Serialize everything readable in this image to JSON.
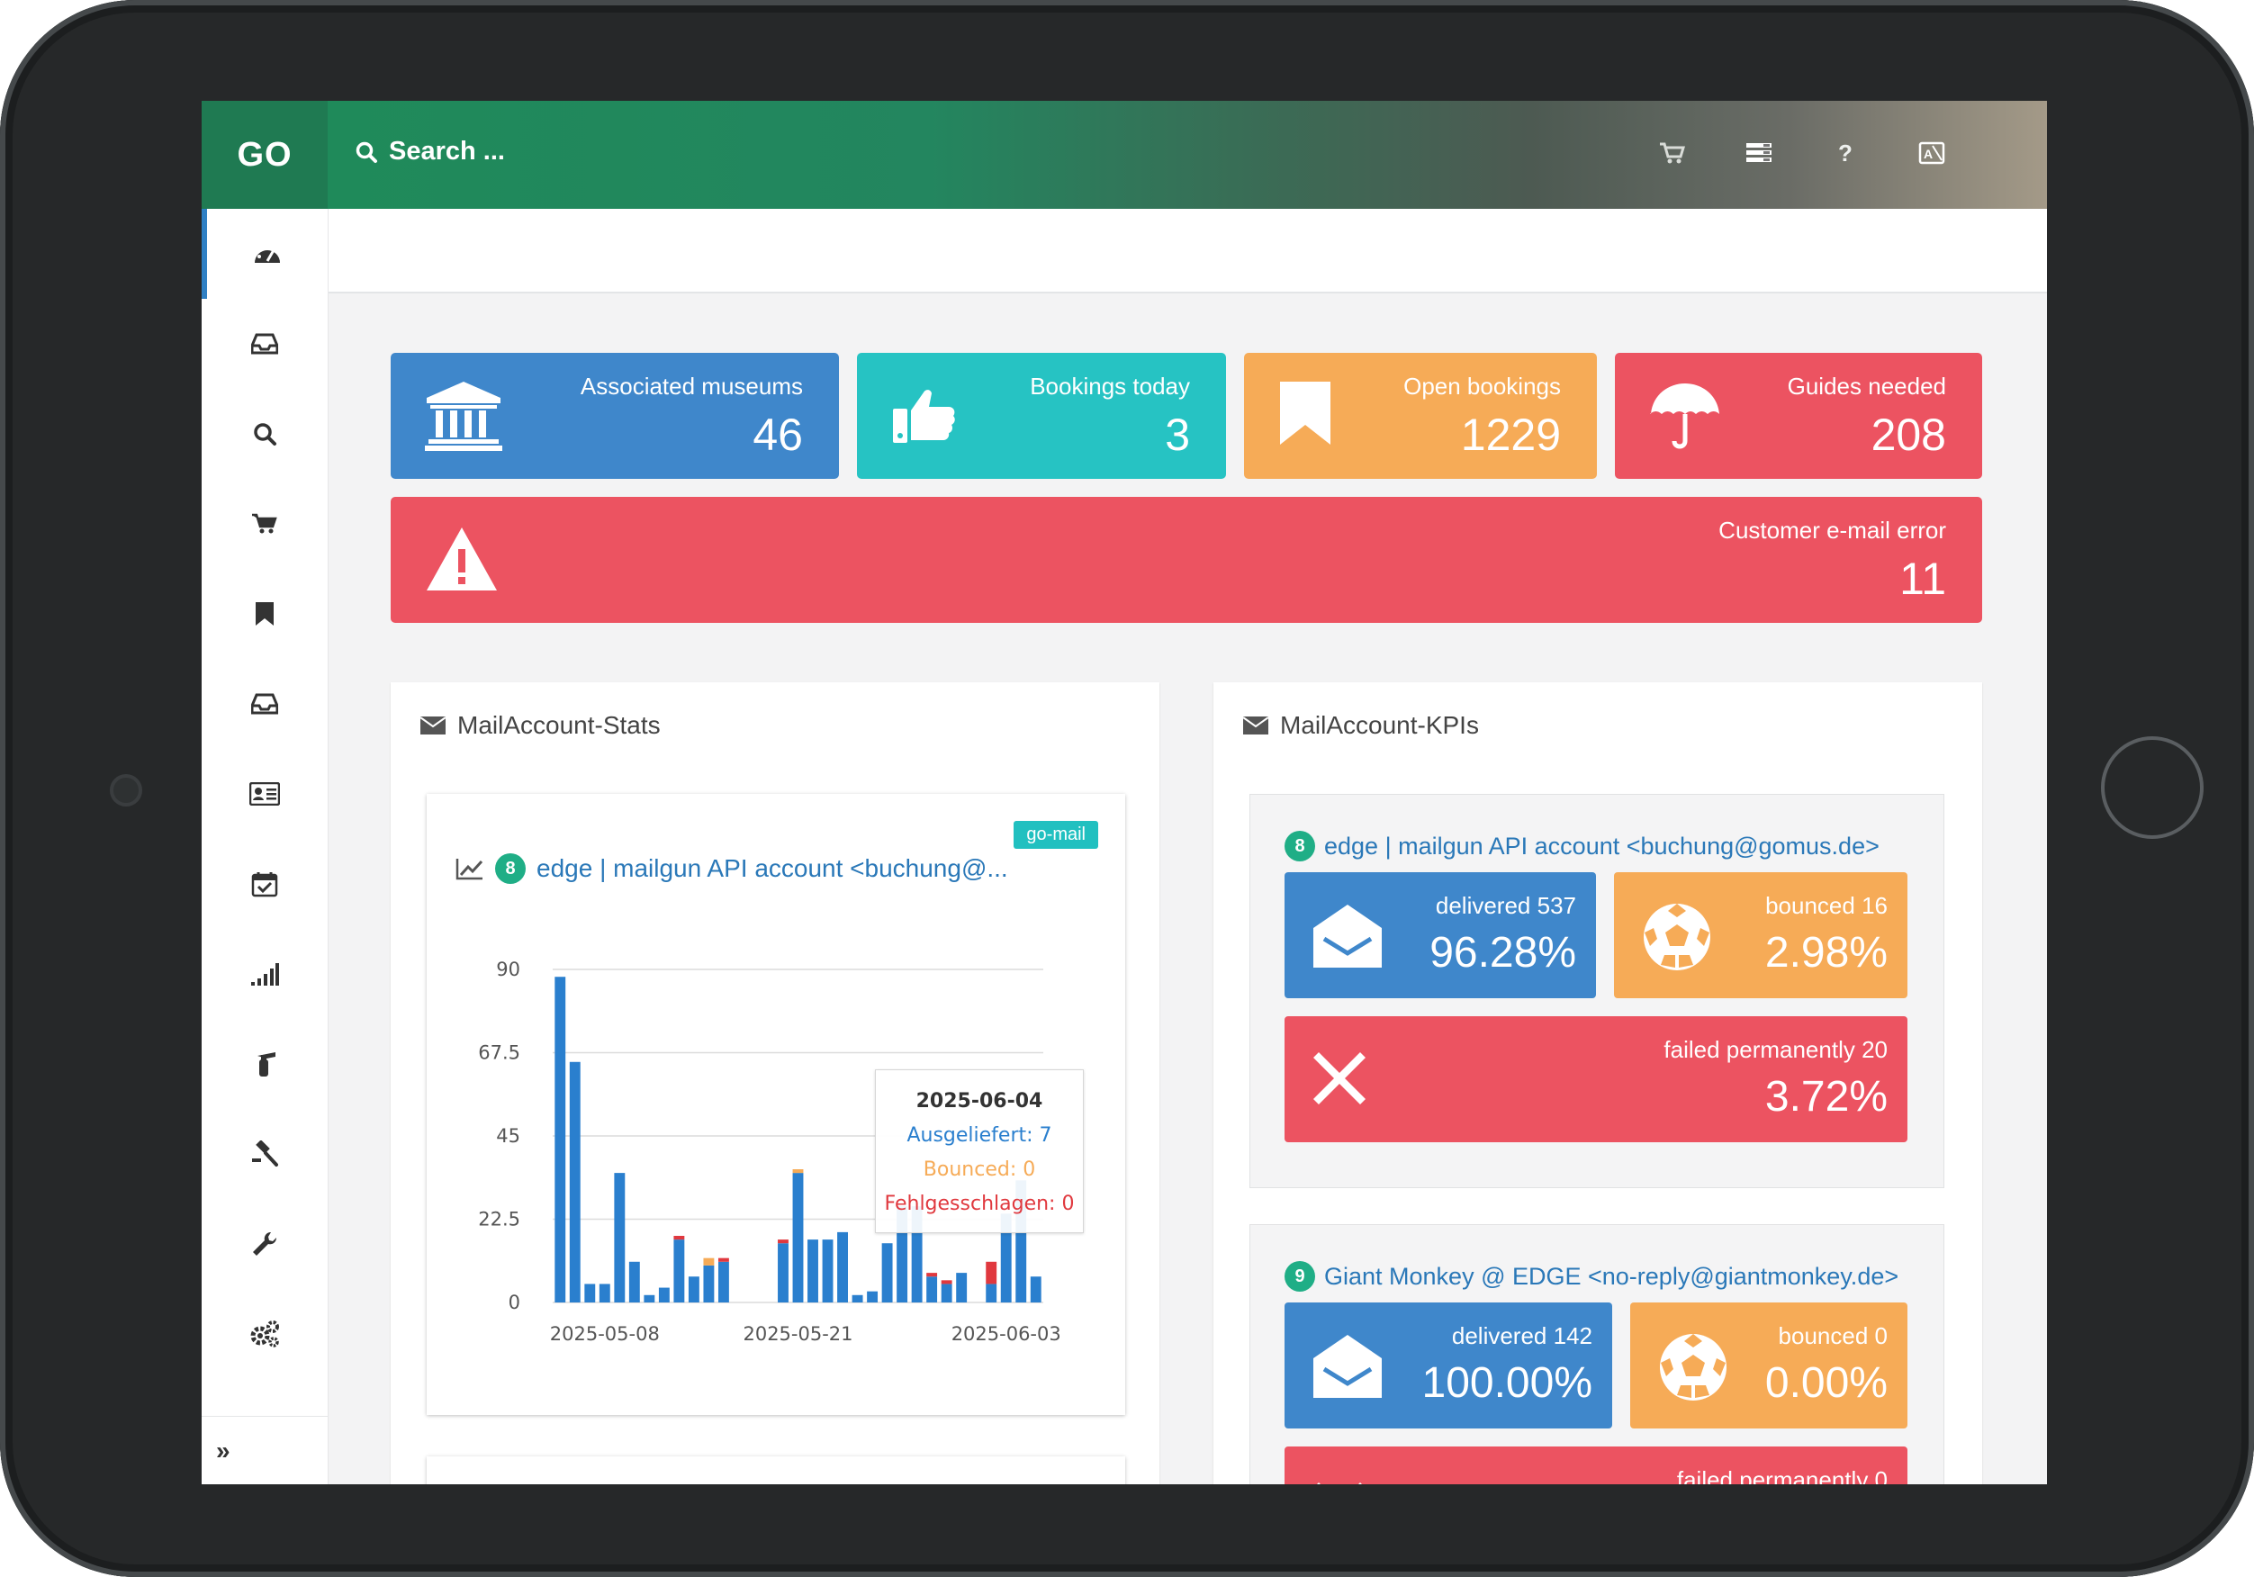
{
  "app": {
    "logo": "GO",
    "search_placeholder": "Search ..."
  },
  "topbar_icons": [
    "cart-icon",
    "list-icon",
    "help-icon",
    "language-icon"
  ],
  "topbar_help": "?",
  "sidebar": {
    "items": [
      "dashboard-icon",
      "inbox-icon",
      "search-icon",
      "cart-icon",
      "bookmark-icon",
      "inbox-icon",
      "contact-card-icon",
      "calendar-check-icon",
      "signal-icon",
      "fire-extinguisher-icon",
      "gavel-icon",
      "wrench-icon",
      "gears-icon"
    ],
    "expand": "»"
  },
  "stats": {
    "museums": {
      "label": "Associated museums",
      "value": "46"
    },
    "bookings_today": {
      "label": "Bookings today",
      "value": "3"
    },
    "open_bookings": {
      "label": "Open bookings",
      "value": "1229"
    },
    "guides_needed": {
      "label": "Guides needed",
      "value": "208"
    },
    "email_error": {
      "label": "Customer e-mail error",
      "value": "11"
    }
  },
  "stats_panel": {
    "title": "MailAccount-Stats",
    "card": {
      "badge": "go-mail",
      "number": "8",
      "title": "edge | mailgun API account <buchung@..."
    },
    "tooltip": {
      "date": "2025-06-04",
      "delivered": "Ausgeliefert: 7",
      "bounced": "Bounced: 0",
      "failed": "Fehlgesschlagen: 0"
    }
  },
  "kpi_panel": {
    "title": "MailAccount-KPIs",
    "accounts": [
      {
        "number": "8",
        "name": "edge | mailgun API account <buchung@gomus.de>",
        "delivered_label": "delivered 537",
        "delivered_pct": "96.28%",
        "bounced_label": "bounced 16",
        "bounced_pct": "2.98%",
        "failed_label": "failed permanently 20",
        "failed_pct": "3.72%"
      },
      {
        "number": "9",
        "name": "Giant Monkey @ EDGE <no-reply@giantmonkey.de>",
        "delivered_label": "delivered 142",
        "delivered_pct": "100.00%",
        "bounced_label": "bounced 0",
        "bounced_pct": "0.00%",
        "failed_label": "failed permanently 0"
      }
    ]
  },
  "colors": {
    "blue": "#3f87cb",
    "teal": "#26c3c3",
    "orange": "#f6ab57",
    "red": "#ec5361",
    "green": "#1f7a52"
  },
  "chart_data": {
    "type": "bar",
    "stacked": true,
    "x_tick_labels": [
      "2025-05-08",
      "2025-05-21",
      "2025-06-03"
    ],
    "y_ticks": [
      "0",
      "22.5",
      "45",
      "67.5",
      "90"
    ],
    "ylim": [
      0,
      90
    ],
    "series": [
      {
        "name": "Ausgeliefert",
        "color": "#2a7fce",
        "values": [
          88,
          65,
          5,
          5,
          35,
          11,
          2,
          4,
          17,
          7,
          10,
          11,
          0,
          0,
          0,
          16,
          35,
          17,
          17,
          19,
          2,
          3,
          16,
          26,
          26,
          7,
          5,
          8,
          0,
          5,
          24,
          33,
          7
        ]
      },
      {
        "name": "Bounced",
        "color": "#f6ab57",
        "values": [
          0,
          0,
          0,
          0,
          0,
          0,
          0,
          0,
          0,
          0,
          2,
          0,
          0,
          0,
          0,
          0,
          1,
          0,
          0,
          0,
          0,
          0,
          0,
          0,
          0,
          0,
          0,
          0,
          0,
          0,
          0,
          0,
          0
        ]
      },
      {
        "name": "Fehlgesschlagen",
        "color": "#e0383e",
        "values": [
          0,
          0,
          0,
          0,
          0,
          0,
          0,
          0,
          1,
          0,
          0,
          1,
          0,
          0,
          0,
          1,
          0,
          0,
          0,
          0,
          0,
          0,
          0,
          0,
          0,
          1,
          1,
          0,
          0,
          6,
          0,
          0,
          0
        ]
      }
    ]
  }
}
